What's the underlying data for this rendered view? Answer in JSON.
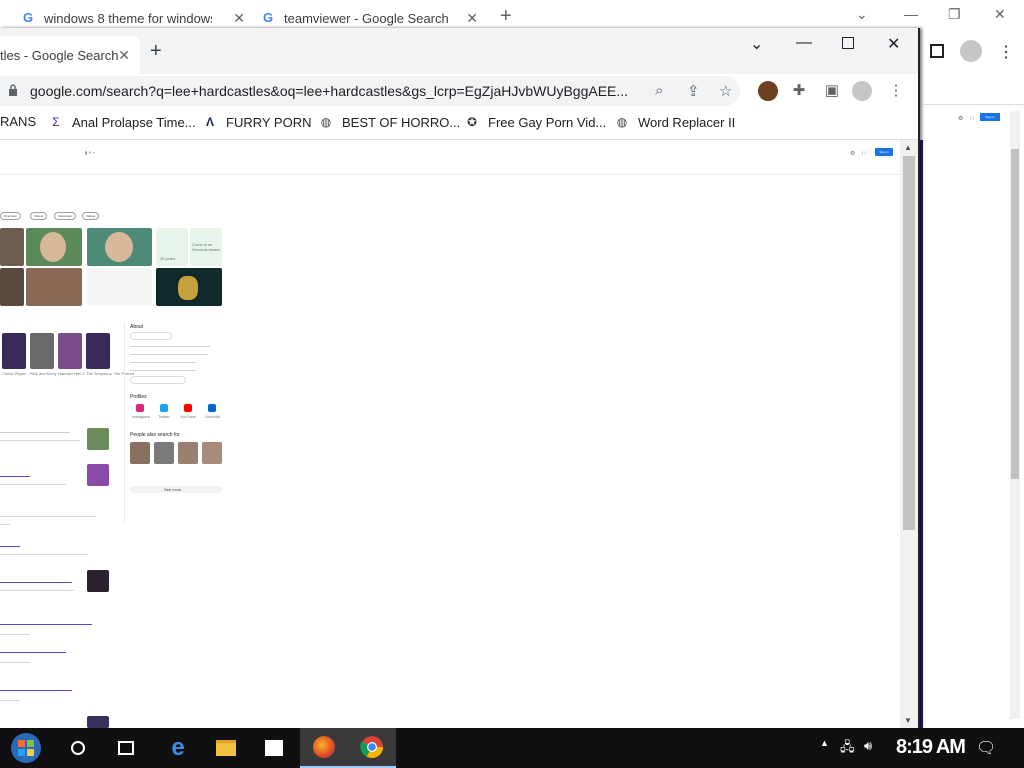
{
  "background_window": {
    "tabs": [
      {
        "label": "windows 8 theme for windows 1"
      },
      {
        "label": "teamviewer - Google Search"
      }
    ],
    "signin_label": "Sign in"
  },
  "front_window": {
    "tab": {
      "label": "tles - Google Search"
    },
    "url": "google.com/search?q=lee+hardcastles&oq=lee+hardcastles&gs_lcrp=EgZjaHJvbWUyBggAEE...",
    "bookmarks": [
      {
        "label": "RANS",
        "icon": "globe-icon"
      },
      {
        "label": "Anal Prolapse Time...",
        "icon": "bookmark-icon"
      },
      {
        "label": "FURRY PORN",
        "icon": "a-logo-icon"
      },
      {
        "label": "BEST OF HORRO...",
        "icon": "globe-icon"
      },
      {
        "label": "Free Gay Porn Vid...",
        "icon": "site-icon"
      },
      {
        "label": "Word Replacer II",
        "icon": "globe-icon"
      }
    ]
  },
  "page": {
    "signin_label": "Sign in",
    "chips": [
      "Overview",
      "Videos",
      "Interviews",
      "Videos"
    ],
    "about_label": "About",
    "profiles_label": "Profiles",
    "profile_names": [
      "Instagram",
      "Twitter",
      "YouTube",
      "LinkedIn"
    ],
    "people_label": "People also search for",
    "see_more_label": "See more",
    "age_text": "35 years",
    "comes_text": "Come in as Seconds Award",
    "video_labels": [
      "Chess Player",
      "Rick and Morty",
      "Hamster Hell 2",
      "The Simpsons: The Picture"
    ]
  },
  "taskbar": {
    "clock": "8:19 AM",
    "active_app": "chrome"
  },
  "colors": {
    "taskbar": "#101010",
    "accent": "#1a73e8",
    "purple_line": "#2c1a7a"
  }
}
